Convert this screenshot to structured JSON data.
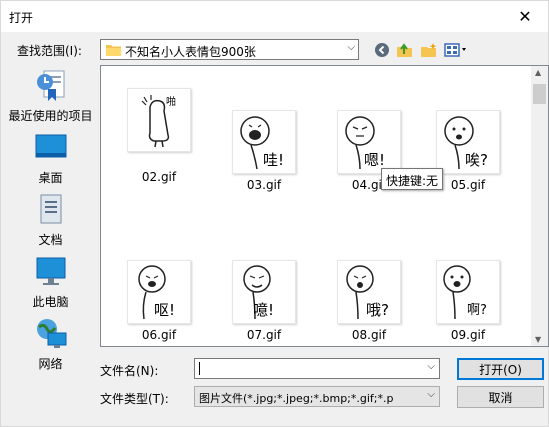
{
  "window": {
    "title": "打开",
    "close_glyph": "✕"
  },
  "lookin": {
    "label": "查找范围(I):",
    "folder": "不知名小人表情包900张",
    "toolbar": [
      "back-arrow-icon",
      "up-folder-icon",
      "new-folder-icon",
      "view-menu-icon"
    ]
  },
  "places": [
    {
      "label": "最近使用的项目",
      "icon": "recent-items-icon"
    },
    {
      "label": "桌面",
      "icon": "desktop-icon"
    },
    {
      "label": "文档",
      "icon": "documents-icon"
    },
    {
      "label": "此电脑",
      "icon": "this-pc-icon"
    },
    {
      "label": "网络",
      "icon": "network-icon"
    }
  ],
  "files": [
    {
      "name": "02.gif",
      "caption": "啪"
    },
    {
      "name": "03.gif",
      "caption": "哇!"
    },
    {
      "name": "04.gif",
      "caption": "嗯!"
    },
    {
      "name": "05.gif",
      "caption": "唉?"
    },
    {
      "name": "06.gif",
      "caption": "呕!"
    },
    {
      "name": "07.gif",
      "caption": "噫!"
    },
    {
      "name": "08.gif",
      "caption": "哦?"
    },
    {
      "name": "09.gif",
      "caption": "啊?"
    }
  ],
  "tooltip": "快捷键:无",
  "filename": {
    "label": "文件名(N):",
    "value": ""
  },
  "filetype": {
    "label": "文件类型(T):",
    "value": "图片文件(*.jpg;*.jpeg;*.bmp;*.gif;*.p"
  },
  "buttons": {
    "open": "打开(O)",
    "cancel": "取消"
  },
  "colors": {
    "accent": "#0078d7",
    "folder": "#f5c451"
  }
}
